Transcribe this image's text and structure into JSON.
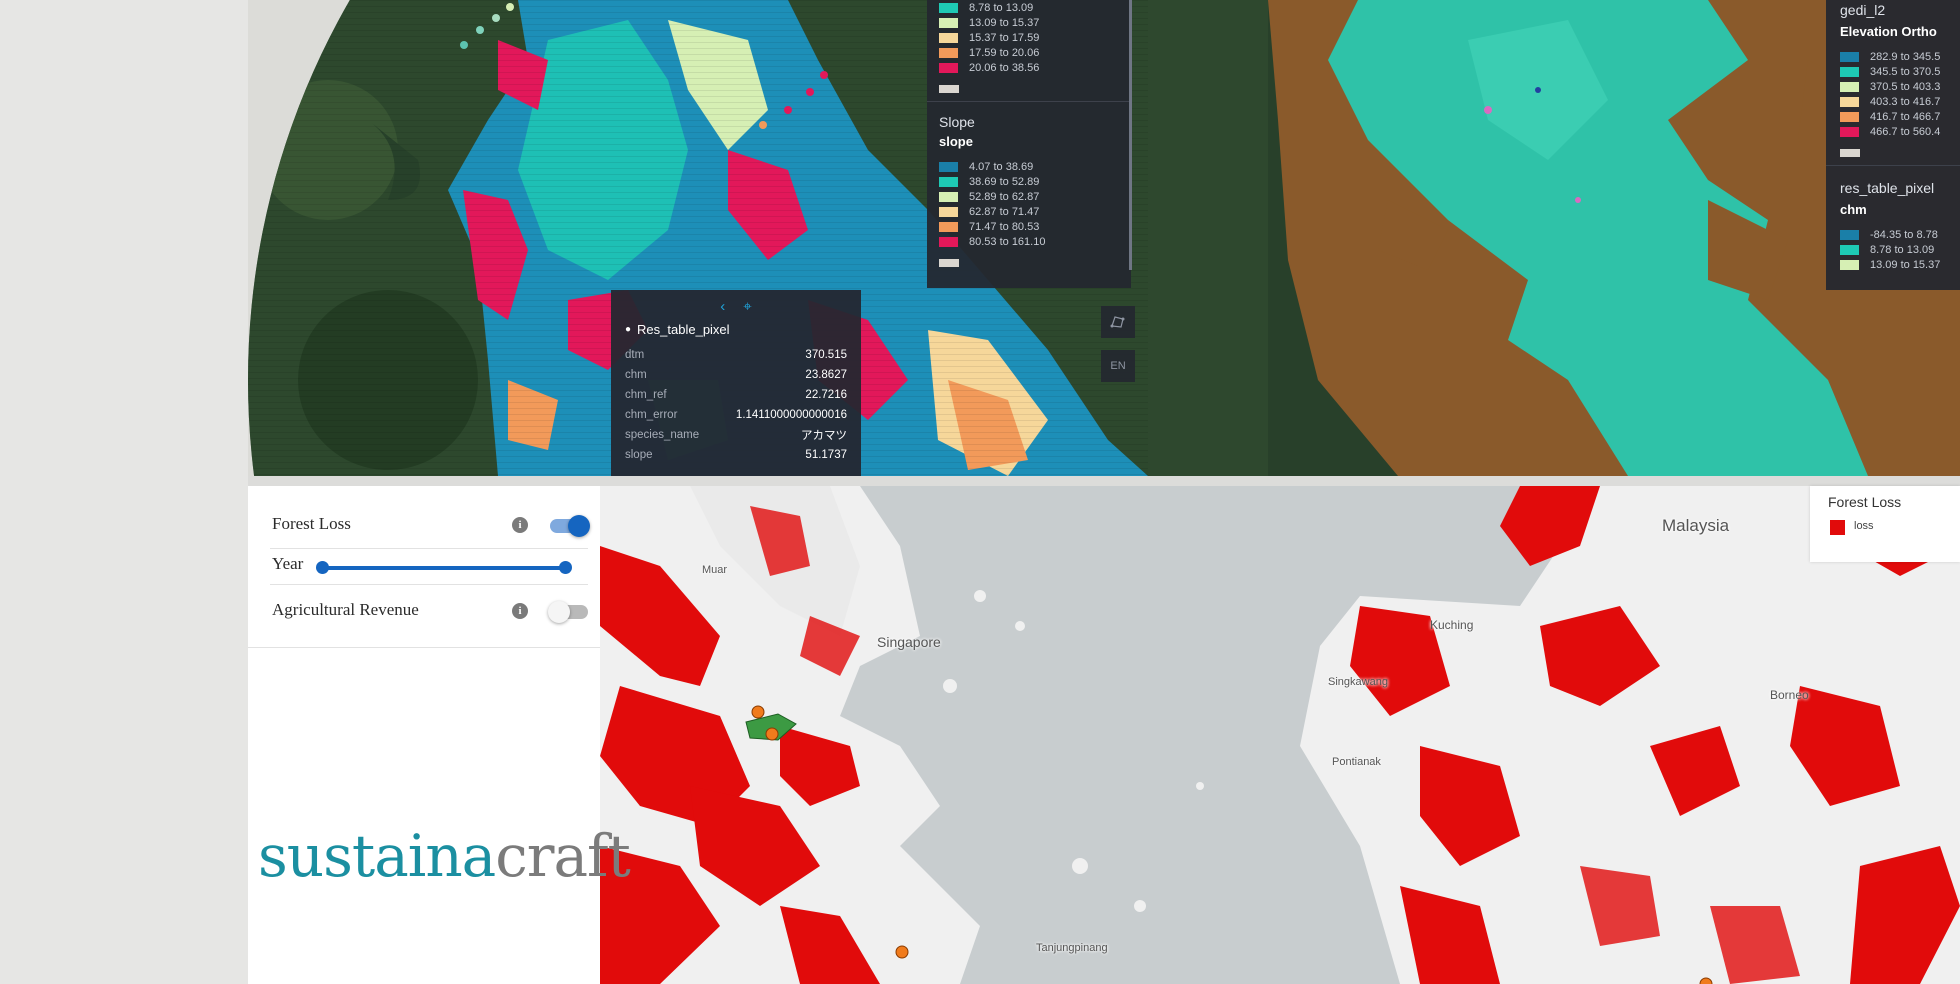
{
  "tooltip": {
    "title": "Res_table_pixel",
    "rows": [
      {
        "key": "dtm",
        "value": "370.515"
      },
      {
        "key": "chm",
        "value": "23.8627"
      },
      {
        "key": "chm_ref",
        "value": "22.7216"
      },
      {
        "key": "chm_error",
        "value": "1.1411000000000016"
      },
      {
        "key": "species_name",
        "value": "アカマツ"
      },
      {
        "key": "slope",
        "value": "51.1737"
      }
    ]
  },
  "legend_left": {
    "top_rows": [
      "8.78 to 13.09",
      "13.09 to 15.37",
      "15.37 to 17.59",
      "17.59 to 20.06",
      "20.06 to 38.56"
    ],
    "slope_title": "Slope",
    "slope_sub": "slope",
    "slope_rows": [
      "4.07 to 38.69",
      "38.69 to 52.89",
      "52.89 to 62.87",
      "62.87 to 71.47",
      "71.47 to 80.53",
      "80.53 to 161.10"
    ]
  },
  "legend_right": {
    "layer1_title": "gedi_l2",
    "layer1_sub": "Elevation Ortho",
    "layer1_rows": [
      "282.9 to 345.5",
      "345.5 to 370.5",
      "370.5 to 403.3",
      "403.3 to 416.7",
      "416.7 to 466.7",
      "466.7 to 560.4"
    ],
    "layer2_title": "res_table_pixel",
    "layer2_sub": "chm",
    "layer2_rows": [
      "-84.35 to 8.78",
      "8.78 to 13.09",
      "13.09 to 15.37"
    ]
  },
  "legend_colors": [
    "#1a7fa8",
    "#1ec9b4",
    "#d6efb4",
    "#f6d79a",
    "#f29a5a",
    "#e2185a"
  ],
  "map_buttons": {
    "draw_icon": "polygon-draw-icon",
    "lang": "EN"
  },
  "controls": {
    "forest_loss": {
      "label": "Forest Loss",
      "enabled": true
    },
    "year": {
      "label": "Year",
      "range_start": 0,
      "range_end": 1
    },
    "agri_revenue": {
      "label": "Agricultural Revenue",
      "enabled": false
    }
  },
  "logo": {
    "part1": "sustaina",
    "part2": "craft"
  },
  "forest_legend": {
    "title": "Forest Loss",
    "item": "loss",
    "color": "#e10b0b"
  },
  "map_labels": {
    "singapore": "Singapore",
    "malaysia": "Malaysia",
    "kuching": "Kuching",
    "borneo": "Borneo",
    "muar": "Muar",
    "pontianak": "Pontianak",
    "singkawang": "Singkawang",
    "tanjungpinang": "Tanjungpinang"
  }
}
